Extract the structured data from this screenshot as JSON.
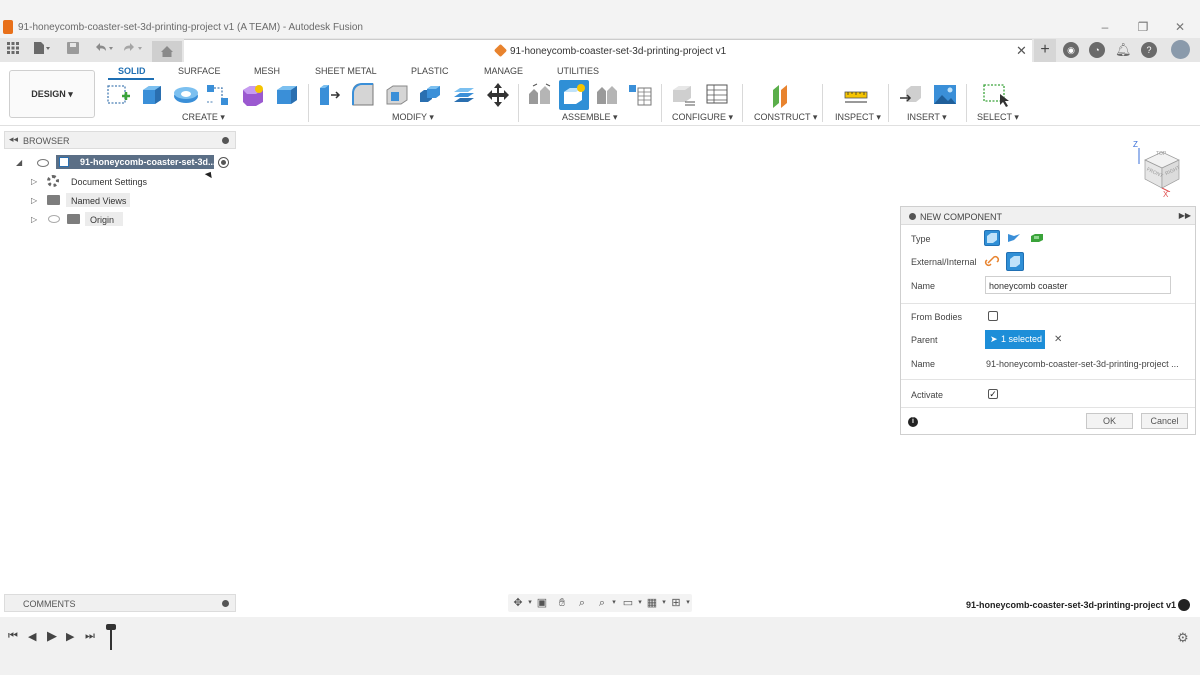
{
  "window": {
    "title": "91-honeycomb-coaster-set-3d-printing-project v1 (A TEAM) - Autodesk Fusion",
    "minimize": "–",
    "restore": "❐",
    "close": "✕"
  },
  "document_tab": {
    "title": "91-honeycomb-coaster-set-3d-printing-project v1",
    "close": "✕",
    "new_tab": "+"
  },
  "quick_access": {
    "grid_icon": "grid-icon",
    "file_icon": "file-icon",
    "save_icon": "save-icon",
    "undo_icon": "undo-icon",
    "redo_icon": "redo-icon",
    "home_icon": "home-icon"
  },
  "header_right_icons": [
    "extensions-icon",
    "job-status-icon",
    "notifications-icon",
    "help-icon",
    "user-avatar"
  ],
  "ribbon": {
    "workspace_button": "DESIGN ▾",
    "tabs": [
      "SOLID",
      "SURFACE",
      "MESH",
      "SHEET METAL",
      "PLASTIC",
      "MANAGE",
      "UTILITIES"
    ],
    "active_tab": "SOLID",
    "groups": [
      {
        "label": "CREATE ▾"
      },
      {
        "label": "MODIFY ▾"
      },
      {
        "label": "ASSEMBLE ▾"
      },
      {
        "label": "CONFIGURE ▾"
      },
      {
        "label": "CONSTRUCT ▾"
      },
      {
        "label": "INSPECT ▾"
      },
      {
        "label": "INSERT ▾"
      },
      {
        "label": "SELECT ▾"
      }
    ],
    "accent_color": "#1f6fb3"
  },
  "browser": {
    "title": "BROWSER",
    "root": "91-honeycomb-coaster-set-3d...",
    "items": [
      "Document Settings",
      "Named Views",
      "Origin"
    ]
  },
  "dialog": {
    "title": "NEW COMPONENT",
    "type_label": "Type",
    "external_internal_label": "External/Internal",
    "name_label": "Name",
    "name_value": "honeycomb coaster",
    "from_bodies_label": "From Bodies",
    "from_bodies_checked": false,
    "parent_label": "Parent",
    "parent_button": "1 selected",
    "parent_clear": "✕",
    "parent_name_label": "Name",
    "parent_name_value": "91-honeycomb-coaster-set-3d-printing-project ...",
    "activate_label": "Activate",
    "activate_checked": true,
    "ok": "OK",
    "cancel": "Cancel",
    "selected_color": "#1d8ed8"
  },
  "comments": {
    "title": "COMMENTS"
  },
  "status": {
    "document_name": "91-honeycomb-coaster-set-3d-printing-project v1"
  },
  "view_cube": {
    "top": "TOP",
    "front": "FRONT",
    "right": "RIGHT",
    "axis_z": "Z",
    "axis_x": "X"
  }
}
